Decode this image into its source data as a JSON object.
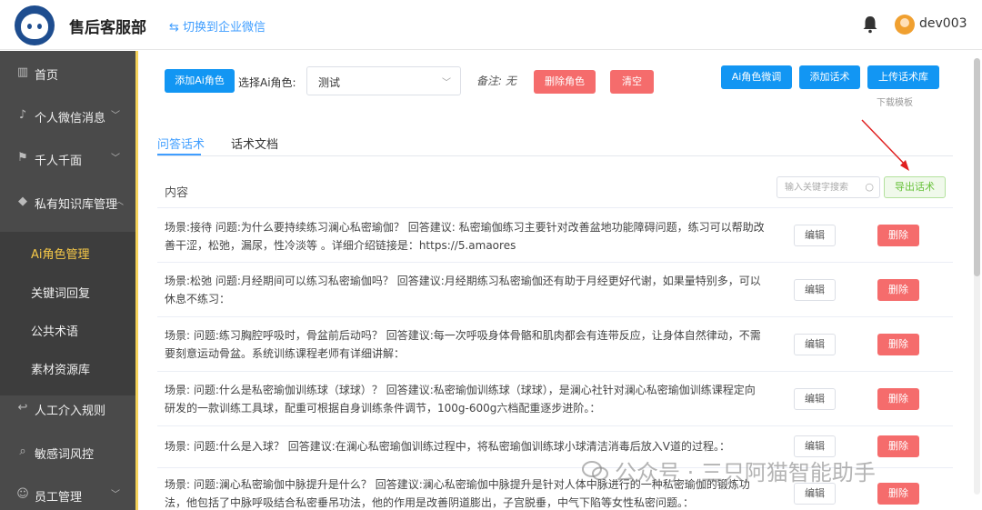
{
  "header": {
    "title": "售后客服部",
    "switch_link": "⇆ 切换到企业微信",
    "username": "dev003"
  },
  "sidebar": {
    "items": [
      {
        "label": "首页",
        "icon": "bar-chart-icon"
      },
      {
        "label": "个人微信消息",
        "icon": "bell-icon"
      },
      {
        "label": "千人千面",
        "icon": "flag-icon"
      },
      {
        "label": "私有知识库管理",
        "icon": "tag-icon"
      },
      {
        "label": "人工介入规则",
        "icon": "reply-icon"
      },
      {
        "label": "敏感词风控",
        "icon": "search-icon"
      },
      {
        "label": "员工管理",
        "icon": "user-add-icon"
      }
    ],
    "sub_items": [
      {
        "label": "Ai角色管理"
      },
      {
        "label": "关键词回复"
      },
      {
        "label": "公共术语"
      },
      {
        "label": "素材资源库"
      }
    ]
  },
  "toolbar": {
    "add_role": "添加Ai角色",
    "select_role_label": "选择Ai角色:",
    "selected_role": "测试",
    "remark": "备注: 无",
    "delete_role": "删除角色",
    "clear": "清空",
    "finetune": "Ai角色微调",
    "add_script": "添加话术",
    "upload_library": "上传话术库",
    "download_template": "下载模板"
  },
  "tabs": [
    {
      "label": "问答话术",
      "active": true
    },
    {
      "label": "话术文档",
      "active": false
    }
  ],
  "table": {
    "header_content": "内容",
    "search_placeholder": "输入关键字搜索",
    "export": "导出话术",
    "edit_label": "编辑",
    "delete_label": "删除",
    "rows": [
      {
        "text": "场景:接待 问题:为什么要持续练习澜心私密瑜伽？ 回答建议: 私密瑜伽练习主要针对改善盆地功能障碍问题，练习可以帮助改善干涩，松弛，漏尿，性冷淡等 。详细介绍链接是：https://5.amaores"
      },
      {
        "text": "场景:松弛 问题:月经期间可以练习私密瑜伽吗？ 回答建议:月经期练习私密瑜伽还有助于月经更好代谢，如果量特别多，可以休息不练习："
      },
      {
        "text": "场景: 问题:练习胸腔呼吸时，骨盆前后动吗？ 回答建议:每一次呼吸身体骨骼和肌肉都会有连带反应，让身体自然律动，不需要刻意运动骨盆。系统训练课程老师有详细讲解："
      },
      {
        "text": "场景: 问题:什么是私密瑜伽训练球（球球）？ 回答建议:私密瑜伽训练球（球球），是澜心社针对澜心私密瑜伽训练课程定向研发的一款训练工具球，配重可根据自身训练条件调节，100g-600g六档配重逐步进阶。："
      },
      {
        "text": "场景: 问题:什么是入球？ 回答建议:在澜心私密瑜伽训练过程中，将私密瑜伽训练球小球清洁消毒后放入V道的过程。："
      },
      {
        "text": "场景: 问题:澜心私密瑜伽中脉提升是什么？ 回答建议:澜心私密瑜伽中脉提升是针对人体中脉进行的一种私密瑜伽的锻炼功法，他包括了中脉呼吸结合私密垂吊功法，他的作用是改善阴道膨出，子宫脱垂，中气下陷等女性私密问题。："
      }
    ]
  },
  "watermark": "公众号 · 三只阿猫智能助手",
  "colors": {
    "primary_blue": "#1296f3",
    "danger_red": "#f56c6c",
    "sidebar_bg": "#4a4a4a",
    "active_yellow": "#f7c948",
    "export_green": "#67c23a",
    "annotation_arrow": "#e02020"
  }
}
